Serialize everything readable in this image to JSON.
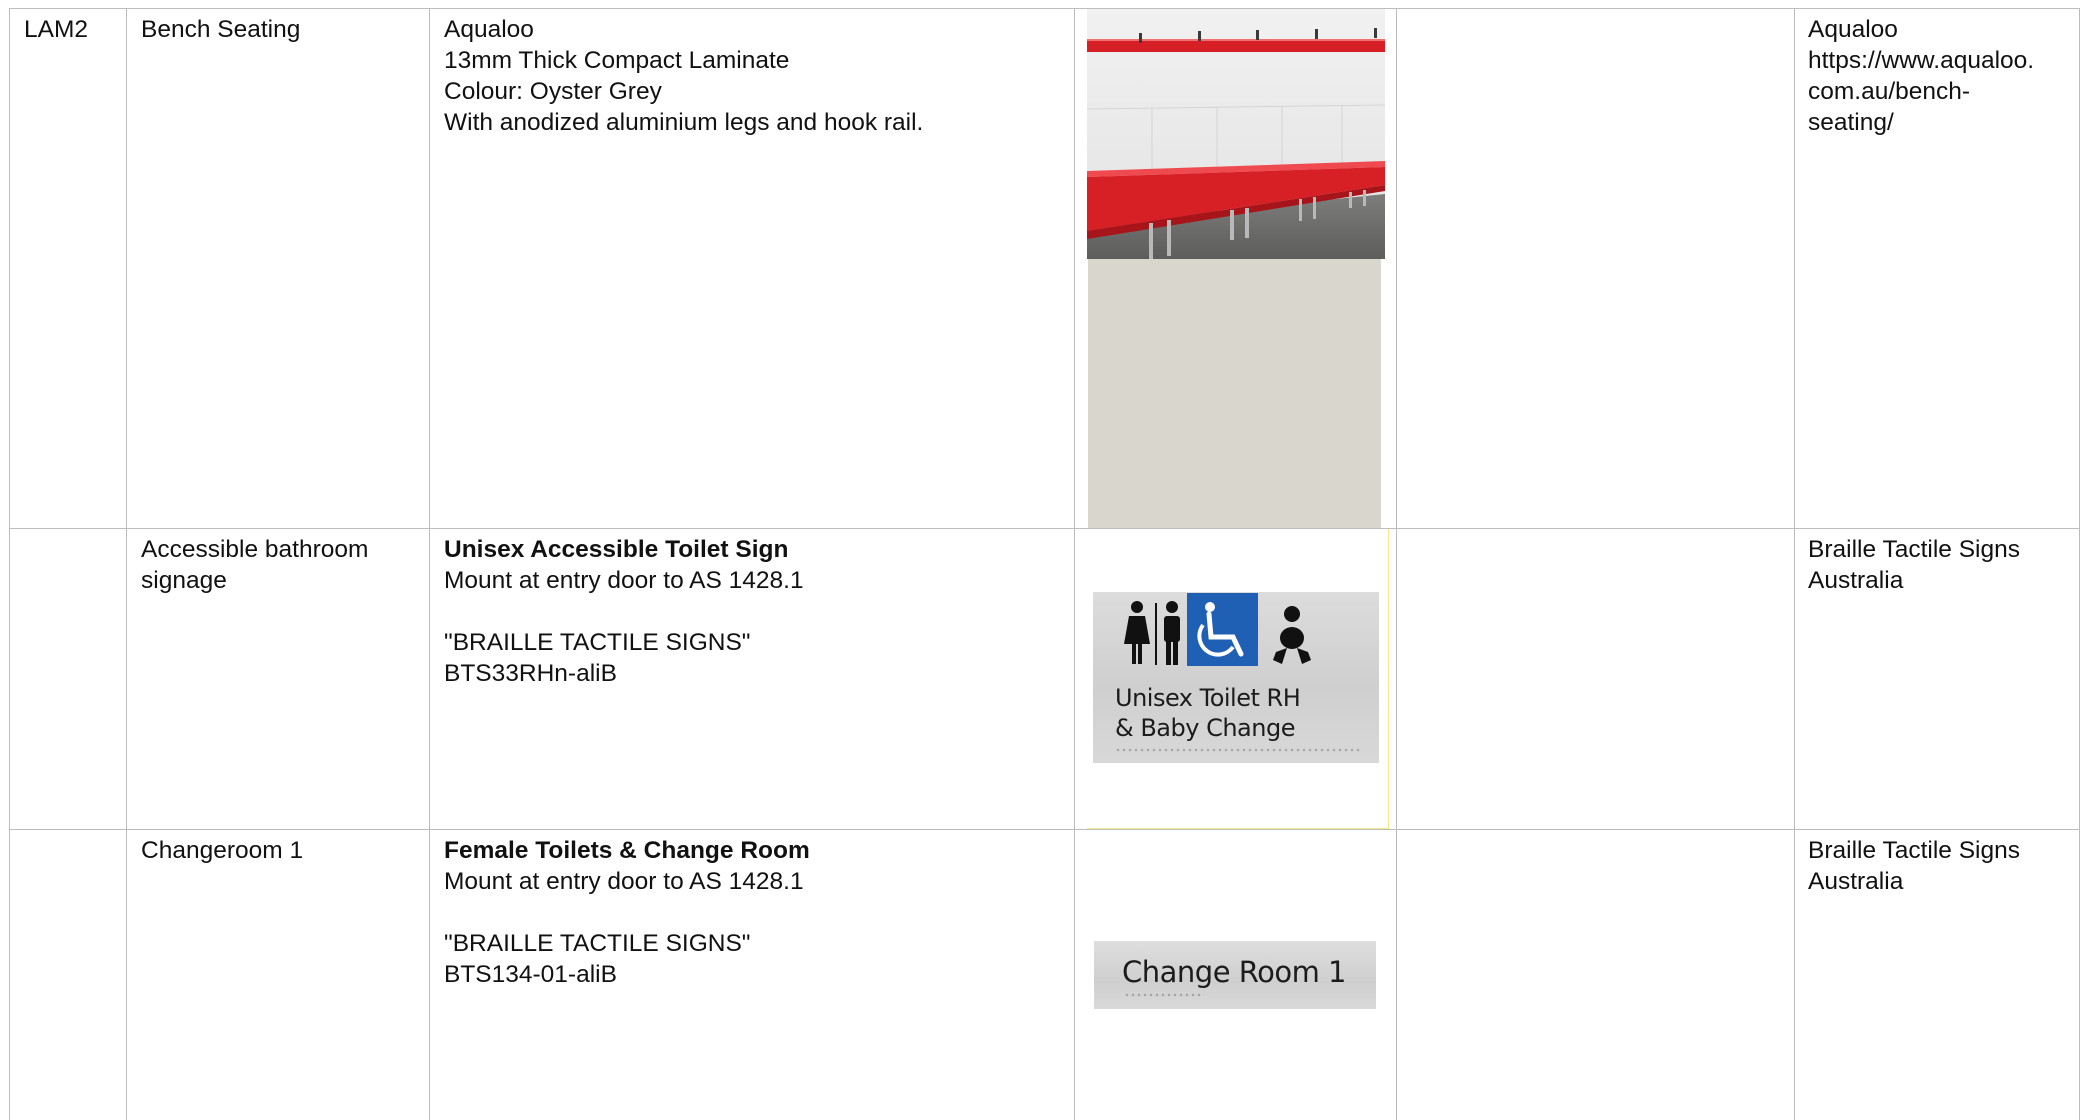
{
  "rows": [
    {
      "code": "LAM2",
      "item": [
        "Bench Seating"
      ],
      "desc": {
        "title": "Aqualoo",
        "title_bold": false,
        "lines": [
          "13mm Thick Compact Laminate",
          "Colour: Oyster Grey",
          "With anodized aluminium legs and hook rail."
        ]
      },
      "image": "bench-seating-photo",
      "notes": "",
      "supplier_lines": [
        "Aqualoo",
        "https://www.aqualoo.",
        "com.au/bench-",
        "seating/"
      ]
    },
    {
      "code": "",
      "item": [
        "Accessible bathroom",
        "signage"
      ],
      "desc": {
        "title": "Unisex Accessible Toilet Sign",
        "title_bold": true,
        "lines": [
          "Mount at entry door to AS 1428.1",
          "",
          "\"BRAILLE TACTILE SIGNS\"",
          "BTS33RHn-aliB"
        ]
      },
      "image": "unisex-toilet-sign",
      "sign_text": [
        "Unisex Toilet RH",
        "& Baby Change"
      ],
      "notes": "",
      "supplier_lines": [
        "Braille Tactile Signs",
        "Australia"
      ]
    },
    {
      "code": "",
      "item": [
        "Changeroom 1"
      ],
      "desc": {
        "title": "Female Toilets & Change Room",
        "title_bold": true,
        "lines": [
          "Mount at entry door to AS 1428.1",
          "",
          "\"BRAILLE TACTILE SIGNS\"",
          "BTS134-01-aliB"
        ]
      },
      "image": "change-room-sign",
      "sign_text": [
        "Change Room 1"
      ],
      "notes": "",
      "supplier_lines": [
        "Braille Tactile Signs",
        "Australia"
      ]
    }
  ],
  "colors": {
    "bench_red": "#d71f26",
    "accessible_blue": "#1f5fb4",
    "sign_brushed": "#d3d3d3",
    "grid": "#bdbdbd"
  }
}
